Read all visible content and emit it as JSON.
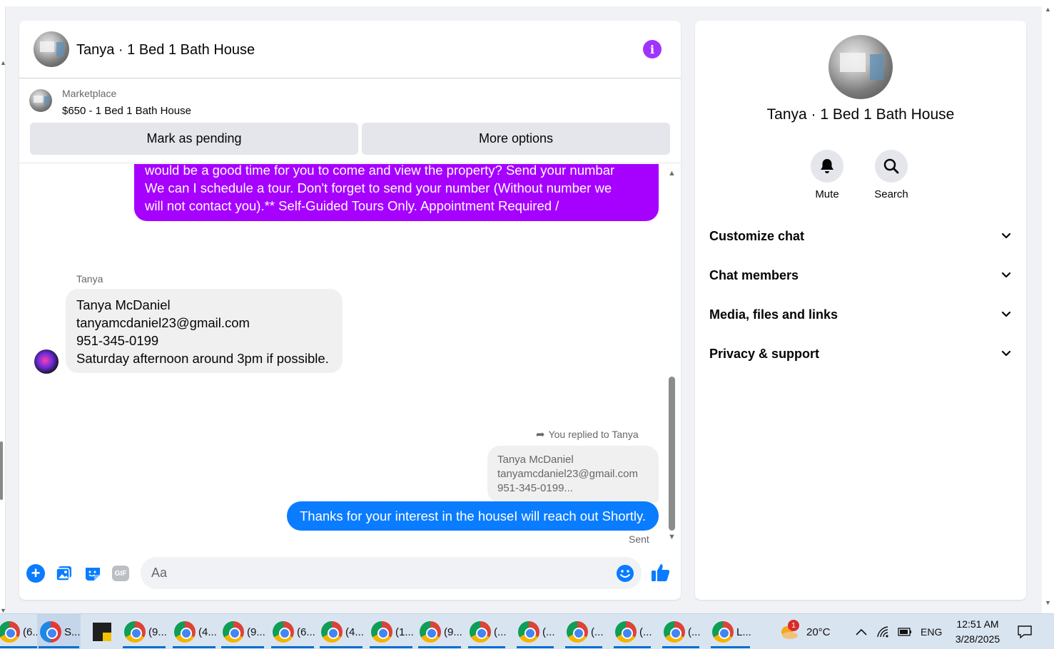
{
  "conversation": {
    "title": "Tanya · 1 Bed 1 Bath House"
  },
  "listing": {
    "source_label": "Marketplace",
    "title": "$650 - 1 Bed 1 Bath House",
    "mark_pending_label": "Mark as pending",
    "more_options_label": "More options"
  },
  "messages": {
    "outgoing_1": {
      "lines": [
        "would be a good time for you to come and view the property? Send your numbar",
        "We can I schedule a tour.  Don't forget to send your number (Without number we",
        "will not contact you).** Self-Guided Tours Only. Appointment Required /"
      ]
    },
    "incoming_1": {
      "sender": "Tanya",
      "lines": [
        "Tanya McDaniel",
        "tanyamcdaniel23@gmail.com",
        "951-345-0199",
        "Saturday afternoon around 3pm if possible."
      ]
    },
    "reply_note": "You replied to Tanya",
    "quoted_lines": [
      "Tanya McDaniel",
      "tanyamcdaniel23@gmail.com",
      "951-345-0199..."
    ],
    "outgoing_2": "Thanks for your interest in the houseI will reach out Shortly.",
    "status": "Sent"
  },
  "composer": {
    "placeholder": "Aa",
    "gif_label": "GIF"
  },
  "info_panel": {
    "title": "Tanya · 1 Bed 1 Bath House",
    "mute_label": "Mute",
    "search_label": "Search",
    "sections": [
      "Customize chat",
      "Chat members",
      "Media, files and links",
      "Privacy & support"
    ]
  },
  "taskbar": {
    "items": [
      {
        "label": "(6...",
        "icon": "chrome-icon"
      },
      {
        "label": "S...",
        "icon": "snipping-tool-icon"
      },
      {
        "label": "",
        "icon": "sticky-notes-icon"
      },
      {
        "label": "(9...",
        "icon": "chrome-icon"
      },
      {
        "label": "(4...",
        "icon": "chrome-icon"
      },
      {
        "label": "(9...",
        "icon": "chrome-icon"
      },
      {
        "label": "(6...",
        "icon": "chrome-icon"
      },
      {
        "label": "(4...",
        "icon": "chrome-icon"
      },
      {
        "label": "(1...",
        "icon": "chrome-icon"
      },
      {
        "label": "(9...",
        "icon": "chrome-icon"
      },
      {
        "label": "(...",
        "icon": "chrome-icon"
      },
      {
        "label": "(...",
        "icon": "chrome-icon"
      },
      {
        "label": "(...",
        "icon": "chrome-icon"
      },
      {
        "label": "(...",
        "icon": "chrome-icon"
      },
      {
        "label": "(...",
        "icon": "chrome-icon"
      },
      {
        "label": "L...",
        "icon": "chrome-icon"
      }
    ],
    "weather_badge": "1",
    "temperature": "20°C",
    "language": "ENG",
    "time": "12:51 AM",
    "date": "3/28/2025"
  },
  "colors": {
    "messenger_blue": "#0a7cff",
    "purple_bubble": "#a600ff",
    "info_purple": "#a033ff"
  }
}
